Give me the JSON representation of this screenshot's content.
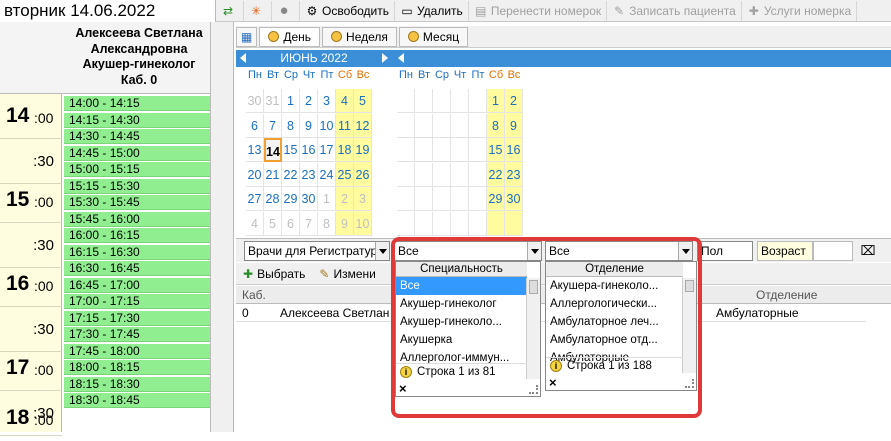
{
  "date_title": "вторник 14.06.2022",
  "toolbar": {
    "release": "Освободить",
    "delete": "Удалить",
    "transfer": "Перенести номерок",
    "record_patient": "Записать пациента",
    "services": "Услуги номерка"
  },
  "doctor": {
    "name1": "Алексеева Светлана",
    "name2": "Александровна",
    "specialty": "Акушер-гинеколог",
    "cabinet": "Каб. 0"
  },
  "hours": [
    {
      "hour": "14",
      "min": ":00",
      "half": ":30"
    },
    {
      "hour": "15",
      "min": ":00",
      "half": ":30"
    },
    {
      "hour": "16",
      "min": ":00",
      "half": ":30"
    },
    {
      "hour": "17",
      "min": ":00",
      "half": ":30"
    },
    {
      "hour": "18",
      "min": ":00",
      "half": ""
    }
  ],
  "slots": [
    "14:00 - 14:15",
    "14:15 - 14:30",
    "14:30 - 14:45",
    "14:45 - 15:00",
    "15:00 - 15:15",
    "15:15 - 15:30",
    "15:30 - 15:45",
    "15:45 - 16:00",
    "16:00 - 16:15",
    "16:15 - 16:30",
    "16:30 - 16:45",
    "16:45 - 17:00",
    "17:00 - 17:15",
    "17:15 - 17:30",
    "17:30 - 17:45",
    "17:45 - 18:00",
    "18:00 - 18:15",
    "18:15 - 18:30",
    "18:30 - 18:45"
  ],
  "views": {
    "day": "День",
    "week": "Неделя",
    "month": "Месяц"
  },
  "calendar": {
    "month_title": "ИЮНЬ 2022",
    "dow": [
      "Пн",
      "Вт",
      "Ср",
      "Чт",
      "Пт",
      "Сб",
      "Вс"
    ],
    "weeks_left": [
      [
        "30",
        "31",
        "1",
        "2",
        "3",
        "4",
        "5"
      ],
      [
        "6",
        "7",
        "8",
        "9",
        "10",
        "11",
        "12"
      ],
      [
        "13",
        "14",
        "15",
        "16",
        "17",
        "18",
        "19"
      ],
      [
        "20",
        "21",
        "22",
        "23",
        "24",
        "25",
        "26"
      ],
      [
        "27",
        "28",
        "29",
        "30",
        "1",
        "2",
        "3"
      ],
      [
        "4",
        "5",
        "6",
        "7",
        "8",
        "9",
        "10"
      ]
    ],
    "weeks_right": [
      [
        "",
        "",
        "",
        "",
        "",
        "1",
        "2"
      ],
      [
        "",
        "",
        "",
        "",
        "",
        "8",
        "9"
      ],
      [
        "",
        "",
        "",
        "",
        "",
        "15",
        "16"
      ],
      [
        "",
        "",
        "",
        "",
        "",
        "22",
        "23"
      ],
      [
        "",
        "",
        "",
        "",
        "",
        "29",
        "30"
      ],
      [
        "",
        "",
        "",
        "",
        "",
        "",
        ""
      ]
    ]
  },
  "filters": {
    "doctors_group": "Врачи для Регистратуры",
    "specialty_value": "Все",
    "department_value": "Все",
    "gender": "Пол",
    "age": "Возраст"
  },
  "actions": {
    "select": "Выбрать",
    "edit": "Измени"
  },
  "grid": {
    "col_cab": "Каб.",
    "col_dept": "Отделение",
    "row": {
      "cab": "0",
      "name": "Алексеева Светлан",
      "dept": "Амбулаторные"
    }
  },
  "specialty_popup": {
    "header": "Специальность",
    "items": [
      "Все",
      "Акушер-гинеколог",
      "Акушер-гинеколо...",
      "Акушерка",
      "Аллерголог-иммун..."
    ],
    "status": "Строка 1 из 81"
  },
  "department_popup": {
    "header": "Отделение",
    "items": [
      "Акушера-гинеколо...",
      "Аллергологически...",
      "Амбулаторное леч...",
      "Амбулаторное отд...",
      "Амбулаторные"
    ],
    "status": "Строка 1 из 188"
  },
  "close_glyph": "×"
}
